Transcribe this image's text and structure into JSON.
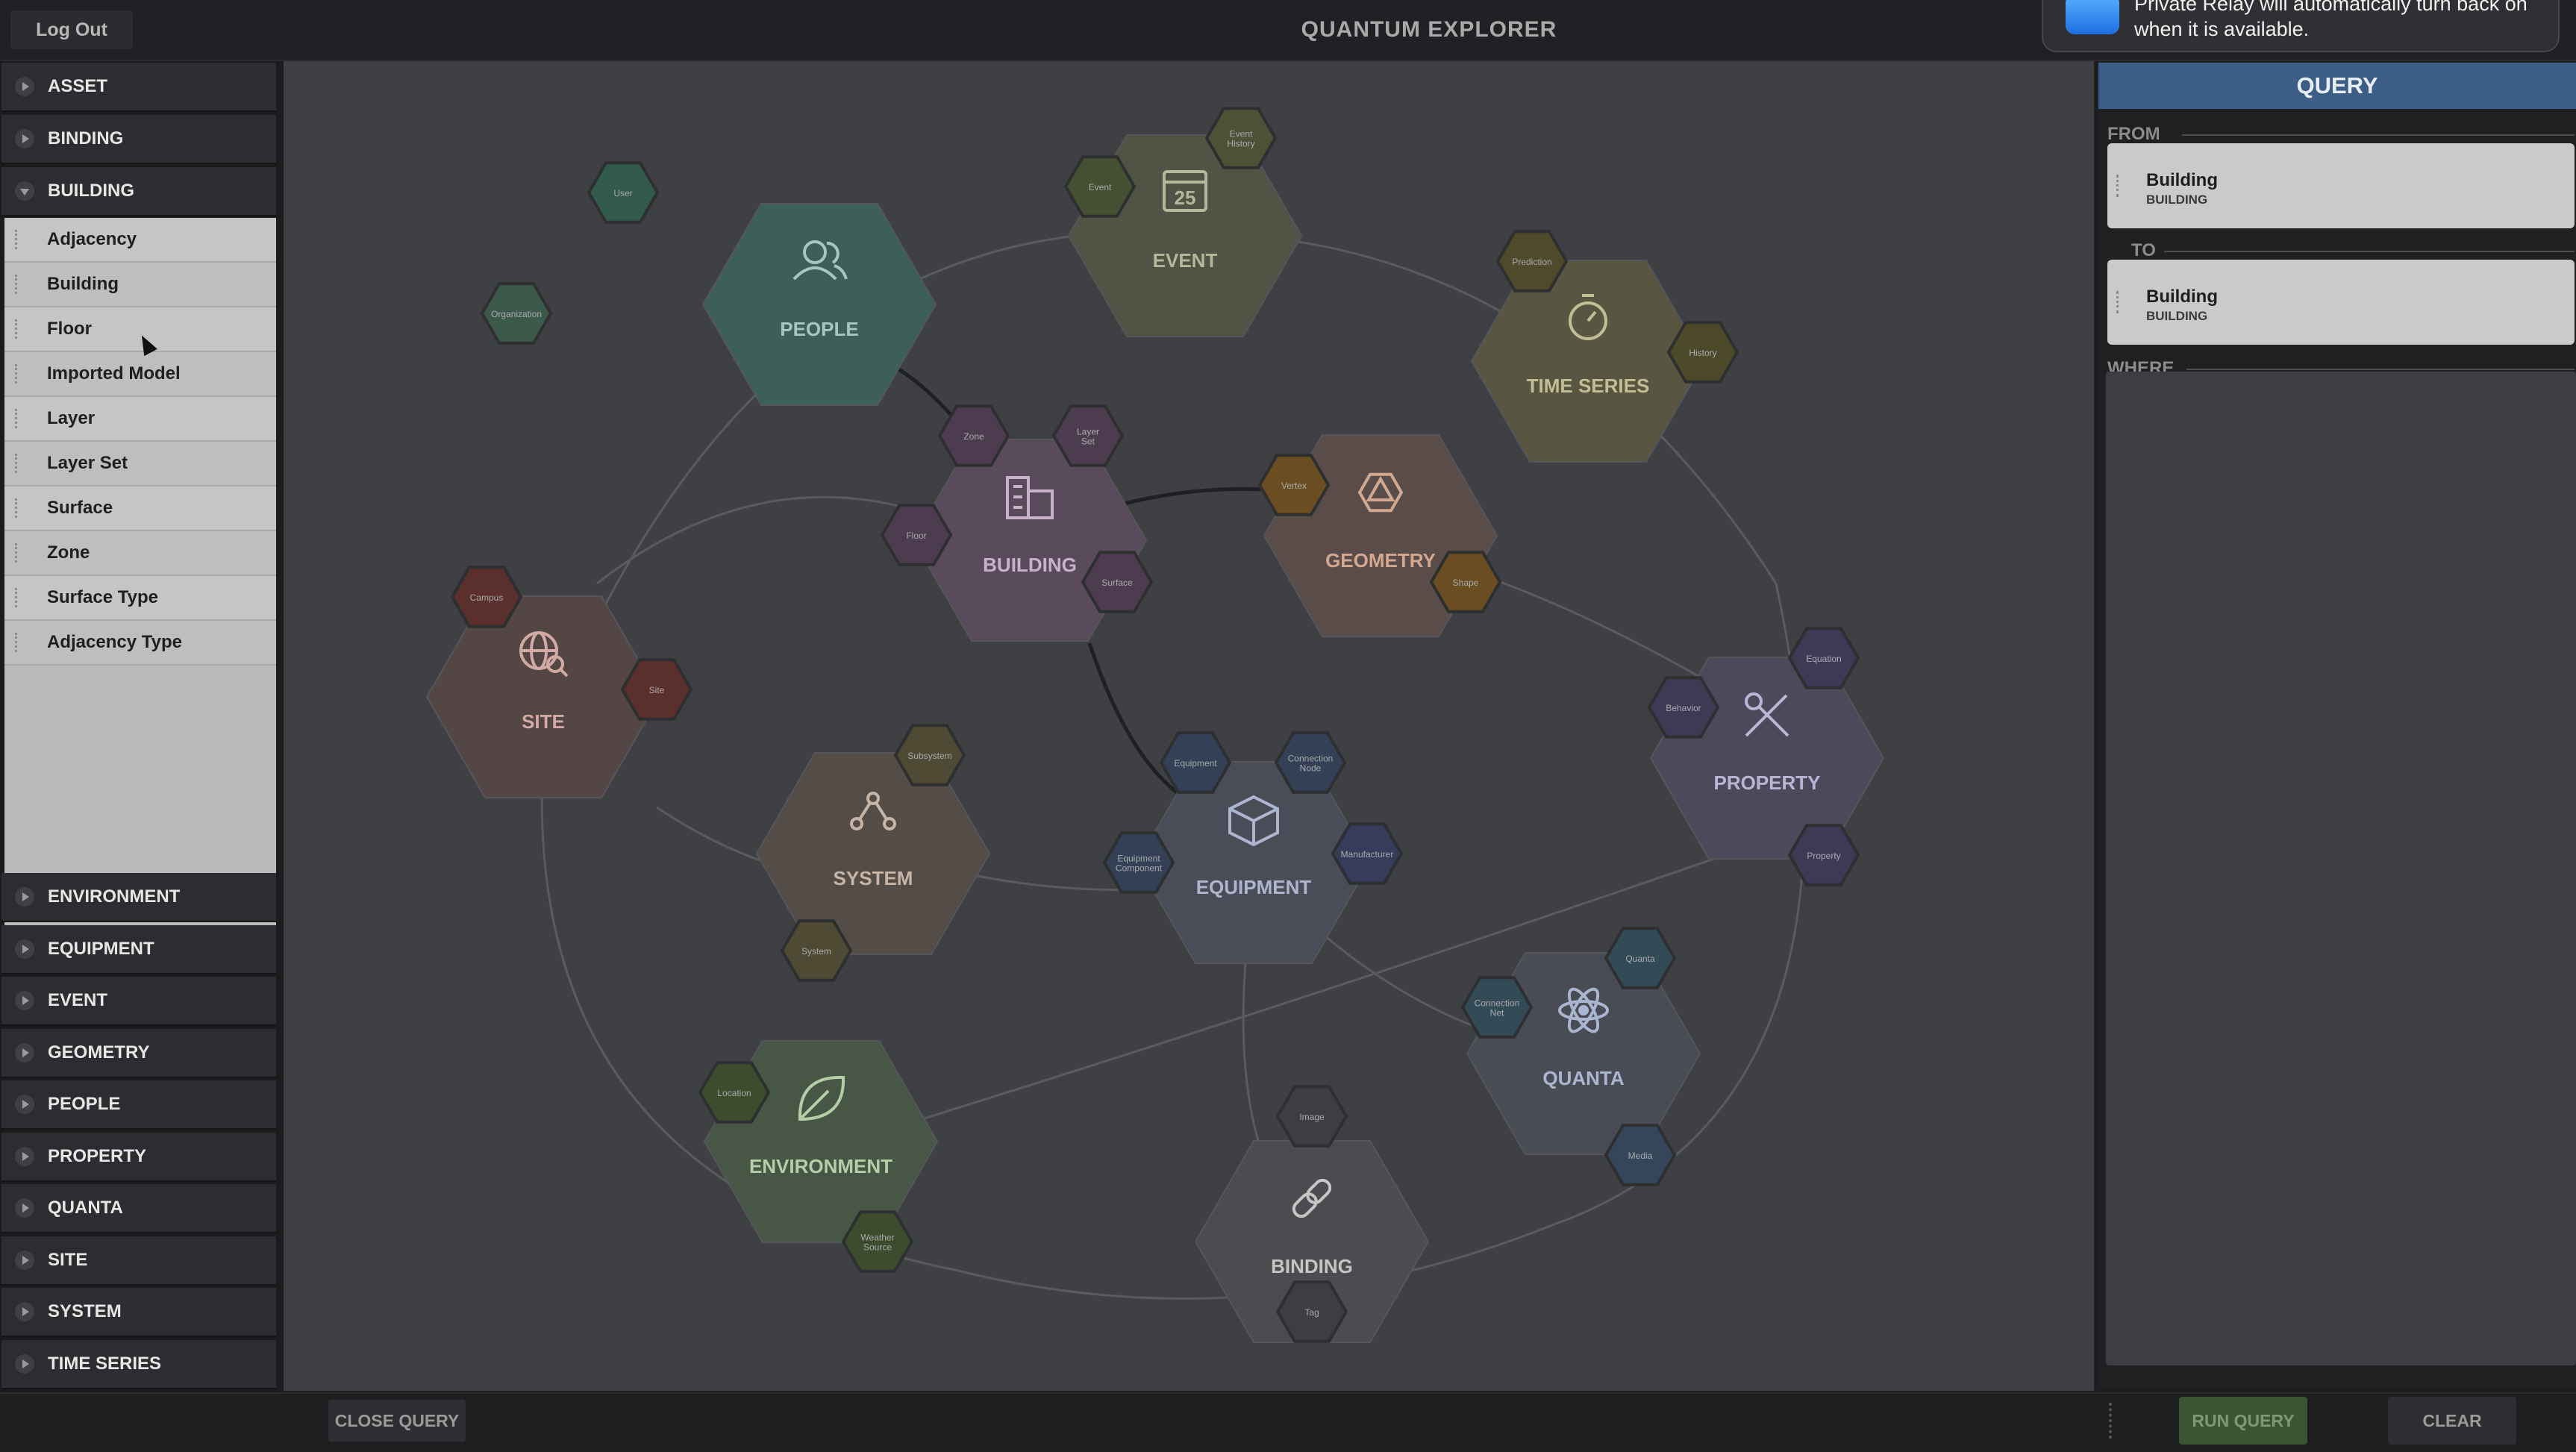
{
  "app": {
    "title": "QUANTUM EXPLORER",
    "logout_label": "Log Out"
  },
  "notification": {
    "text": "Private Relay will automatically turn back on when it is available."
  },
  "sidebar": {
    "categories_top": [
      "ASSET",
      "BINDING",
      "BUILDING"
    ],
    "building_items": [
      "Adjacency",
      "Building",
      "Floor",
      "Imported Model",
      "Layer",
      "Layer Set",
      "Surface",
      "Zone",
      "Surface Type",
      "Adjacency Type"
    ],
    "categories_bottom": [
      "ENVIRONMENT",
      "EQUIPMENT",
      "EVENT",
      "GEOMETRY",
      "PEOPLE",
      "PROPERTY",
      "QUANTA",
      "SITE",
      "SYSTEM",
      "TIME SERIES"
    ]
  },
  "graph": {
    "nodes": [
      {
        "key": "people",
        "label": "PEOPLE",
        "icon": "people-icon",
        "color": "#3d5f5a",
        "text_color": "#a5c7be",
        "subs": [
          {
            "label": "User",
            "color": "#325a4c"
          },
          {
            "label": "Organization",
            "color": "#3b5a4c"
          }
        ]
      },
      {
        "key": "event",
        "label": "EVENT",
        "icon": "calendar-icon",
        "color": "#4f5444",
        "text_color": "#b2b89a",
        "subs": [
          {
            "label": "Event History",
            "color": "#4c5236"
          },
          {
            "label": "Event",
            "color": "#474f33"
          }
        ]
      },
      {
        "key": "timeseries",
        "label": "TIME SERIES",
        "icon": "stopwatch-icon",
        "color": "#585540",
        "text_color": "#c3bd95",
        "subs": [
          {
            "label": "Prediction",
            "color": "#4f4a2c"
          },
          {
            "label": "History",
            "color": "#4d492b"
          }
        ]
      },
      {
        "key": "building",
        "label": "BUILDING",
        "icon": "building-icon",
        "color": "#5a4b5c",
        "text_color": "#c9b0cb",
        "subs": [
          {
            "label": "Zone",
            "color": "#4d3b4f"
          },
          {
            "label": "Layer Set",
            "color": "#4d3b4f"
          },
          {
            "label": "Floor",
            "color": "#4d3b4f"
          },
          {
            "label": "Surface",
            "color": "#4d3b4f"
          }
        ]
      },
      {
        "key": "geometry",
        "label": "GEOMETRY",
        "icon": "polyhedron-icon",
        "color": "#5a4c48",
        "text_color": "#d2a990",
        "subs": [
          {
            "label": "Vertex",
            "color": "#6a4e22"
          },
          {
            "label": "Shape",
            "color": "#6a4e22"
          }
        ]
      },
      {
        "key": "site",
        "label": "SITE",
        "icon": "globe-search-icon",
        "color": "#544644",
        "text_color": "#d2a9a3",
        "subs": [
          {
            "label": "Campus",
            "color": "#5a2f2c"
          },
          {
            "label": "Site",
            "color": "#5a2f2c"
          }
        ]
      },
      {
        "key": "property",
        "label": "PROPERTY",
        "icon": "tools-icon",
        "color": "#4c4a5a",
        "text_color": "#b9b5d4",
        "subs": [
          {
            "label": "Equation",
            "color": "#3d3a56"
          },
          {
            "label": "Behavior",
            "color": "#3d3a56"
          },
          {
            "label": "Property",
            "color": "#3d3a56"
          }
        ]
      },
      {
        "key": "system",
        "label": "SYSTEM",
        "icon": "network-icon",
        "color": "#534c47",
        "text_color": "#c6b4a7",
        "subs": [
          {
            "label": "Subsystem",
            "color": "#4f4a34"
          },
          {
            "label": "System",
            "color": "#4f4a34"
          }
        ]
      },
      {
        "key": "equipment",
        "label": "EQUIPMENT",
        "icon": "box-icon",
        "color": "#4a4c57",
        "text_color": "#aeb6cf",
        "subs": [
          {
            "label": "Equipment",
            "color": "#334055"
          },
          {
            "label": "Connection Node",
            "color": "#334055"
          },
          {
            "label": "Equipment Component",
            "color": "#334055"
          },
          {
            "label": "Manufacturer",
            "color": "#363c5a"
          }
        ]
      },
      {
        "key": "quanta",
        "label": "QUANTA",
        "icon": "atom-icon",
        "color": "#4a4c55",
        "text_color": "#aab5cf",
        "subs": [
          {
            "label": "Quanta",
            "color": "#334a57"
          },
          {
            "label": "Connection Net",
            "color": "#334a57"
          },
          {
            "label": "Media",
            "color": "#34465a"
          }
        ]
      },
      {
        "key": "environment",
        "label": "ENVIRONMENT",
        "icon": "leaf-icon",
        "color": "#485646",
        "text_color": "#b4cfa7",
        "subs": [
          {
            "label": "Location",
            "color": "#3d4c2c"
          },
          {
            "label": "Weather Source",
            "color": "#3d4c2c"
          }
        ]
      },
      {
        "key": "binding",
        "label": "BINDING",
        "icon": "link-icon",
        "color": "#4b4c4f",
        "text_color": "#c5c5c5",
        "subs": [
          {
            "label": "Image",
            "color": "#3d3e41"
          },
          {
            "label": "Tag",
            "color": "#3d3e41"
          }
        ]
      }
    ]
  },
  "query": {
    "title": "QUERY",
    "from_label": "FROM",
    "from": {
      "name": "Building",
      "type": "BUILDING"
    },
    "to_label": "TO",
    "to": {
      "name": "Building",
      "type": "BUILDING"
    },
    "where_label": "WHERE"
  },
  "footer": {
    "close_query": "CLOSE QUERY",
    "run_query": "RUN QUERY",
    "clear": "CLEAR"
  }
}
